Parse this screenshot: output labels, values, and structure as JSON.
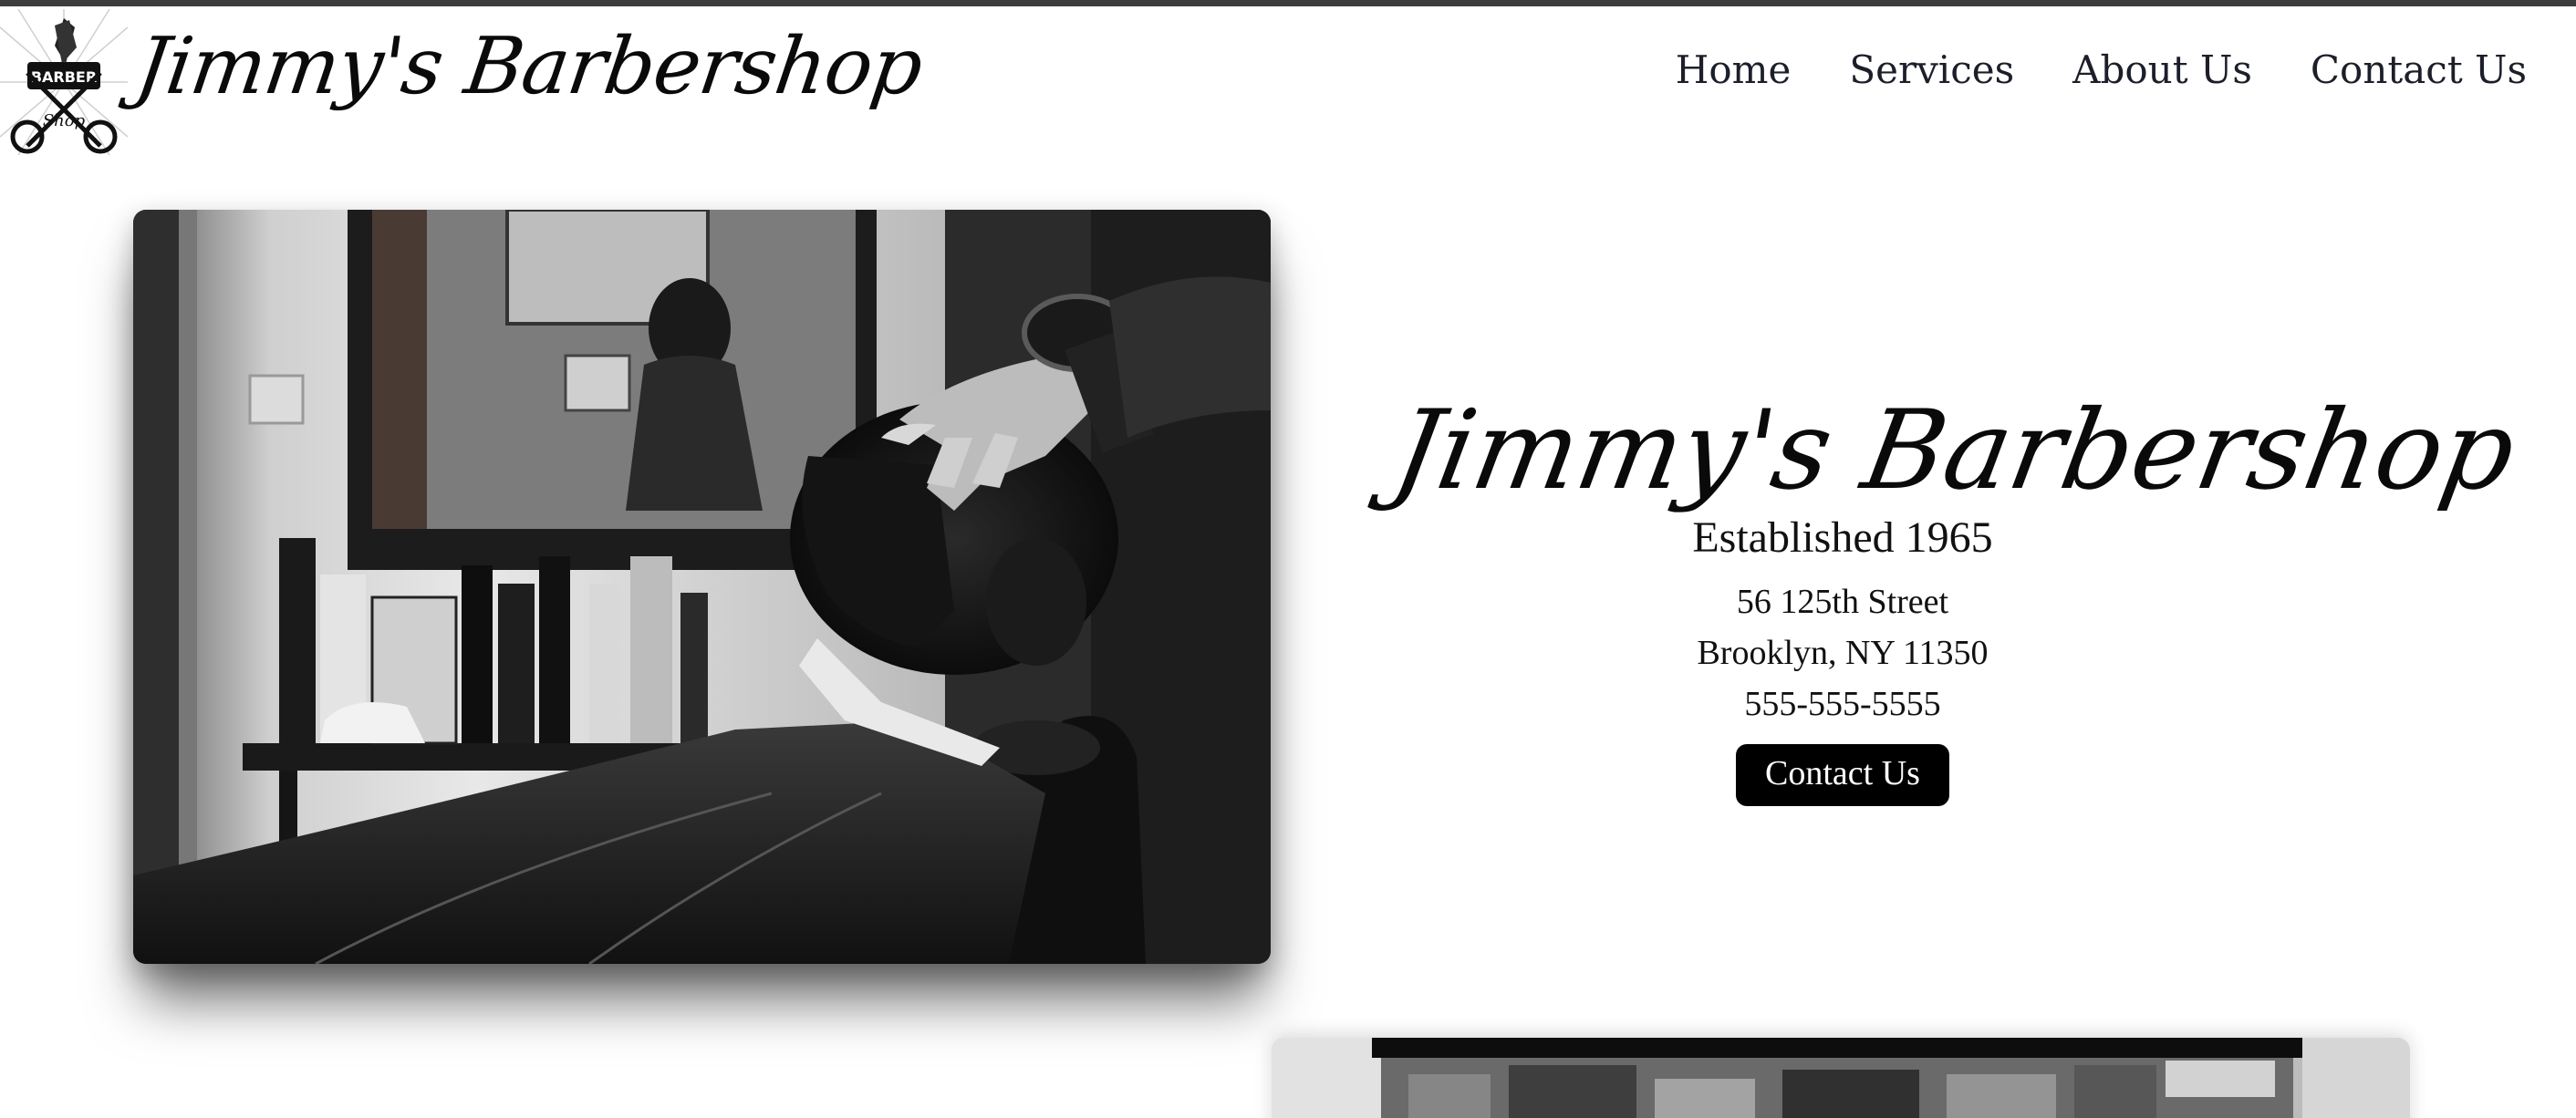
{
  "header": {
    "brand": "Jimmy's Barbershop",
    "logo_icon": "barber-shop-badge-icon"
  },
  "nav": {
    "items": [
      {
        "label": "Home"
      },
      {
        "label": "Services"
      },
      {
        "label": "About Us"
      },
      {
        "label": "Contact Us"
      }
    ]
  },
  "hero": {
    "photo_icon": "barber-photo-image",
    "title": "Jimmy's Barbershop",
    "established": "Established 1965",
    "address_line1": "56 125th Street",
    "address_line2": "Brooklyn, NY 11350",
    "phone": "555-555-5555",
    "cta_label": "Contact Us"
  },
  "colors": {
    "topbar": "#3d3d3d",
    "text": "#111111",
    "nav_text": "#1c1f2a",
    "button_bg": "#000000",
    "button_text": "#ffffff"
  }
}
